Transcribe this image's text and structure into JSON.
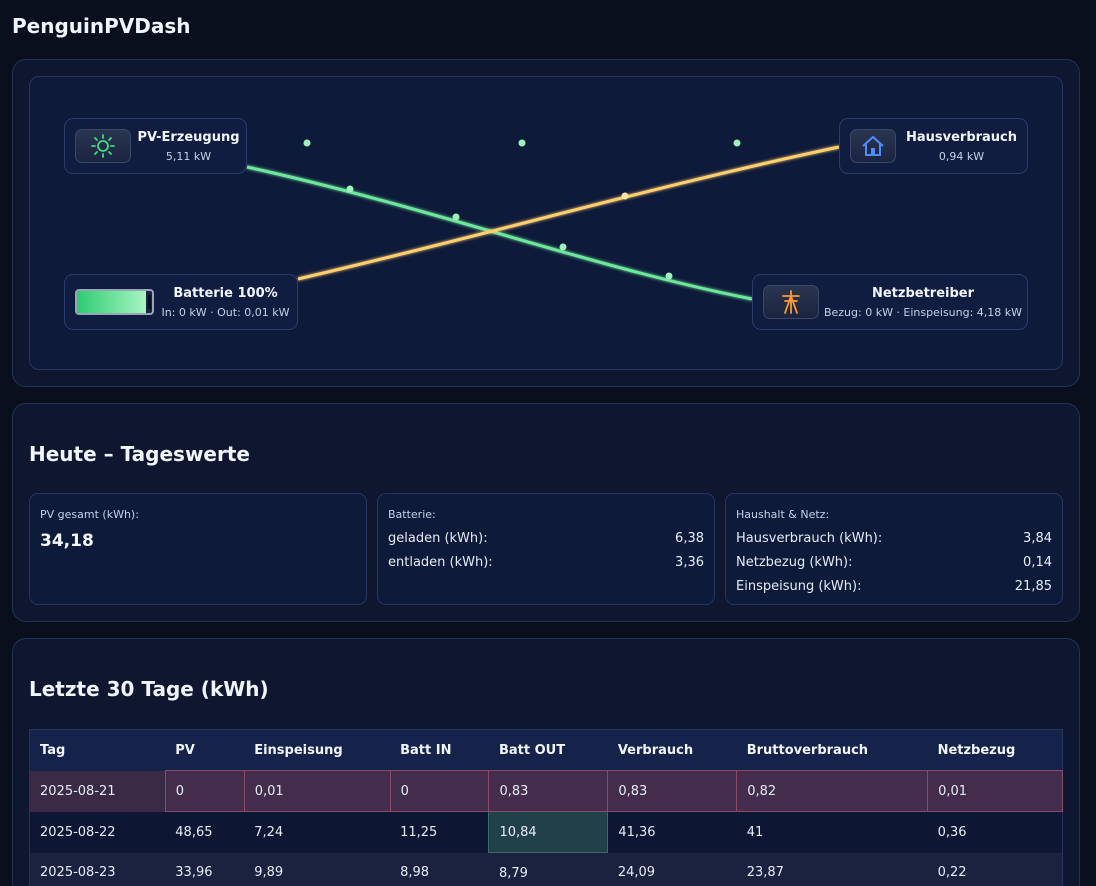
{
  "app": {
    "title": "PenguinPVDash"
  },
  "flow": {
    "pv": {
      "title": "PV-Erzeugung",
      "value": "5,11 kW",
      "icon": "sun-icon"
    },
    "house": {
      "title": "Hausverbrauch",
      "value": "0,94 kW",
      "icon": "house-icon"
    },
    "battery": {
      "title": "Batterie 100%",
      "value": "In: 0 kW · Out: 0,01 kW",
      "level_percent": 100,
      "icon": "battery-icon"
    },
    "grid": {
      "title": "Netzbetreiber",
      "value": "Bezug: 0 kW · Einspeisung: 4,18 kW",
      "icon": "power-tower-icon"
    },
    "colors": {
      "pv_flow": "#6ee79a",
      "battery_flow": "#ffcf6e"
    }
  },
  "today": {
    "title": "Heute – Tageswerte",
    "pv": {
      "label": "PV gesamt (kWh):",
      "value": "34,18"
    },
    "battery": {
      "label": "Batterie:",
      "rows": [
        {
          "label": "geladen (kWh):",
          "value": "6,38"
        },
        {
          "label": "entladen (kWh):",
          "value": "3,36"
        }
      ]
    },
    "net": {
      "label": "Haushalt & Netz:",
      "rows": [
        {
          "label": "Hausverbrauch (kWh):",
          "value": "3,84"
        },
        {
          "label": "Netzbezug (kWh):",
          "value": "0,14"
        },
        {
          "label": "Einspeisung (kWh):",
          "value": "21,85"
        }
      ]
    }
  },
  "history": {
    "title": "Letzte 30 Tage (kWh)",
    "columns": [
      "Tag",
      "PV",
      "Einspeisung",
      "Batt IN",
      "Batt OUT",
      "Verbrauch",
      "Bruttoverbrauch",
      "Netzbezug"
    ],
    "rows": [
      [
        "2025-08-21",
        "0",
        "0,01",
        "0",
        "0,83",
        "0,83",
        "0,82",
        "0,01"
      ],
      [
        "2025-08-22",
        "48,65",
        "7,24",
        "11,25",
        "10,84",
        "41,36",
        "41",
        "0,36"
      ],
      [
        "2025-08-23",
        "33,96",
        "9,89",
        "8,98",
        "8,79",
        "24,09",
        "23,87",
        "0,22"
      ]
    ]
  }
}
